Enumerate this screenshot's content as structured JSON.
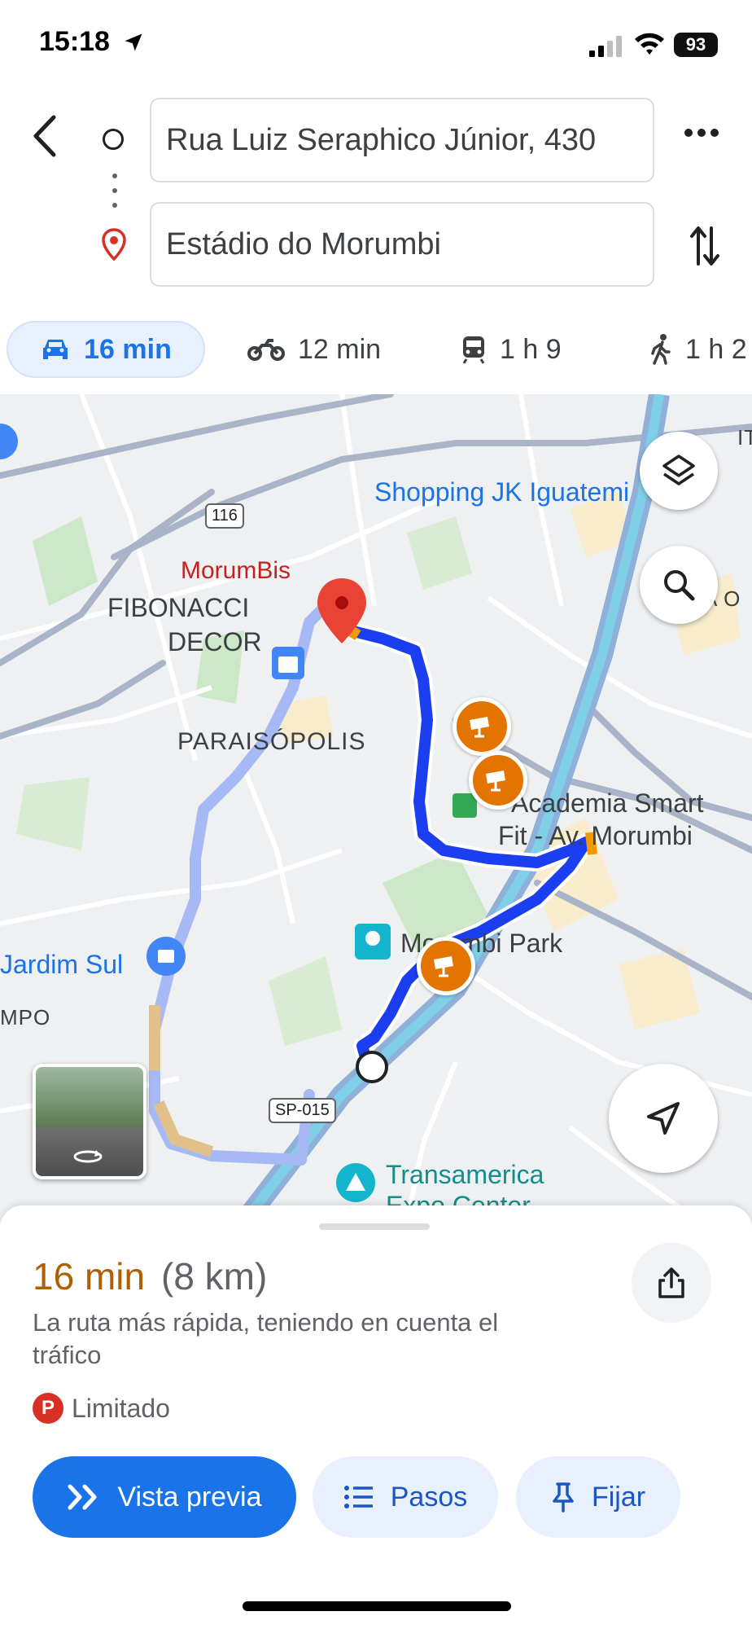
{
  "status_bar": {
    "time": "15:18",
    "battery": "93"
  },
  "directions": {
    "origin": "Rua Luiz Seraphico Júnior, 430",
    "destination": "Estádio do Morumbi"
  },
  "modes": [
    {
      "label": "16 min",
      "icon": "car-icon",
      "selected": true
    },
    {
      "label": "12 min",
      "icon": "motorcycle-icon",
      "selected": false
    },
    {
      "label": "1 h 9",
      "icon": "transit-icon",
      "selected": false
    },
    {
      "label": "1 h 2",
      "icon": "walk-icon",
      "selected": false
    }
  ],
  "map": {
    "labels": {
      "shopping": "Shopping JK Iguatemi",
      "morumbis": "MorumBis",
      "fibonacci_1": "FIBONACCI",
      "fibonacci_2": "DECOR",
      "paraisopolis": "PARAISÓPOLIS",
      "academia_1": "Academia Smart",
      "academia_2": "Fit - Av. Morumbi",
      "park": "Morumbi Park",
      "jardim": "Jardim Sul",
      "transamerica": "Transamerica",
      "transamerica_2": "Expo Center",
      "mpo": "MPO",
      "edge_right_1": "IT",
      "edge_right_2": "A O"
    },
    "shields": {
      "br116": "116",
      "sp015": "SP-015"
    },
    "colors": {
      "route_primary": "#1a3ef0",
      "route_alt": "#a7b9f4",
      "traffic": "#f29900",
      "camera": "#e37400"
    }
  },
  "route": {
    "eta": "16 min",
    "distance": "(8 km)",
    "description": "La ruta más rápida, teniendo en cuenta el tráfico",
    "parking_letter": "P",
    "parking": "Limitado"
  },
  "actions": {
    "preview": "Vista previa",
    "steps": "Pasos",
    "pin": "Fijar"
  }
}
